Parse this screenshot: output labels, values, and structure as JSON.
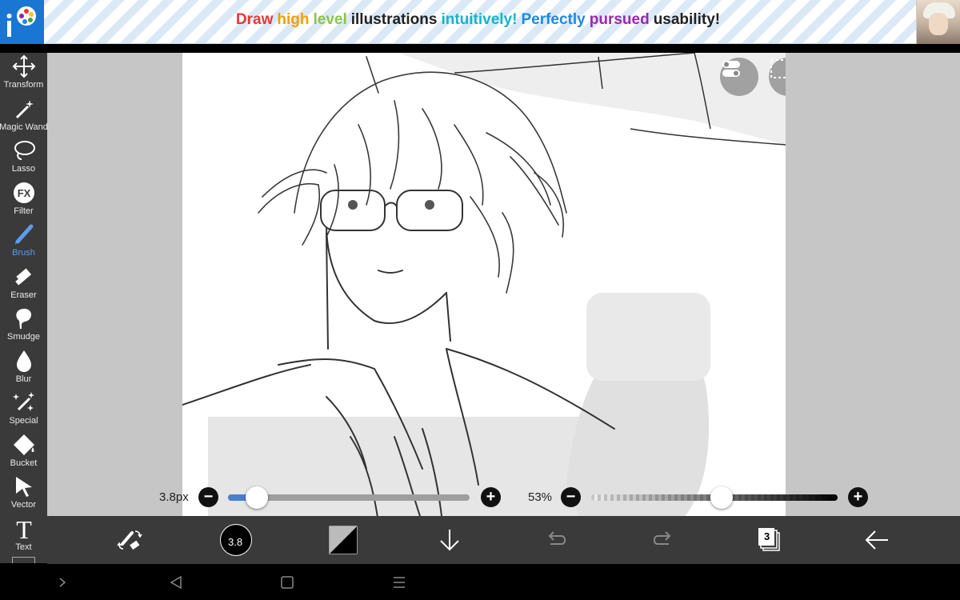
{
  "ad": {
    "logo": "iP",
    "headline": [
      {
        "text": "Draw",
        "color": "#e53935"
      },
      {
        "text": "high",
        "color": "#f59d00"
      },
      {
        "text": "level",
        "color": "#8bc34a"
      },
      {
        "text": "illustrations",
        "color": "#222222"
      },
      {
        "text": "intuitively!",
        "color": "#12b5c8"
      },
      {
        "text": "Perfectly",
        "color": "#1e88e5"
      },
      {
        "text": "pursued",
        "color": "#9c27b0"
      },
      {
        "text": "usability",
        "color": "#222222"
      },
      {
        "text": "!",
        "color": "#222222"
      }
    ]
  },
  "tools": [
    {
      "label": "Transform",
      "icon": "transform-move-icon"
    },
    {
      "label": "Magic Wand",
      "icon": "magic-wand-icon"
    },
    {
      "label": "Lasso",
      "icon": "lasso-icon"
    },
    {
      "label": "Filter",
      "icon": "fx-filter-icon"
    },
    {
      "label": "Brush",
      "icon": "brush-icon",
      "active": true
    },
    {
      "label": "Eraser",
      "icon": "eraser-icon"
    },
    {
      "label": "Smudge",
      "icon": "smudge-icon"
    },
    {
      "label": "Blur",
      "icon": "blur-drop-icon"
    },
    {
      "label": "Special",
      "icon": "special-sparkle-icon"
    },
    {
      "label": "Bucket",
      "icon": "bucket-icon"
    },
    {
      "label": "Vector",
      "icon": "vector-cursor-icon"
    },
    {
      "label": "Text",
      "icon": "text-icon"
    }
  ],
  "overlay_buttons": [
    "toggle-icon",
    "selection-icon",
    "hand-gesture-icon",
    "ruler-icon",
    "image-icon"
  ],
  "brush_size": {
    "label": "3.8px",
    "fraction": 0.12
  },
  "opacity": {
    "label": "53%",
    "fraction": 0.53
  },
  "bottom_bar": {
    "brush_indicator": "3.8",
    "layers_count": "3"
  },
  "colors": {
    "accent": "#4a7fd0",
    "toolbar": "#3a3a3a",
    "workspace": "#c6c6c6"
  }
}
